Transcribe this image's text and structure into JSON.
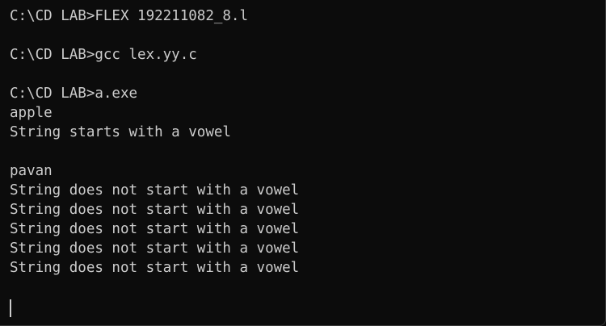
{
  "terminal": {
    "lines": [
      "C:\\CD LAB>FLEX 192211082_8.l",
      "",
      "C:\\CD LAB>gcc lex.yy.c",
      "",
      "C:\\CD LAB>a.exe",
      "apple",
      "String starts with a vowel",
      "",
      "pavan",
      "String does not start with a vowel",
      "String does not start with a vowel",
      "String does not start with a vowel",
      "String does not start with a vowel",
      "String does not start with a vowel"
    ]
  }
}
